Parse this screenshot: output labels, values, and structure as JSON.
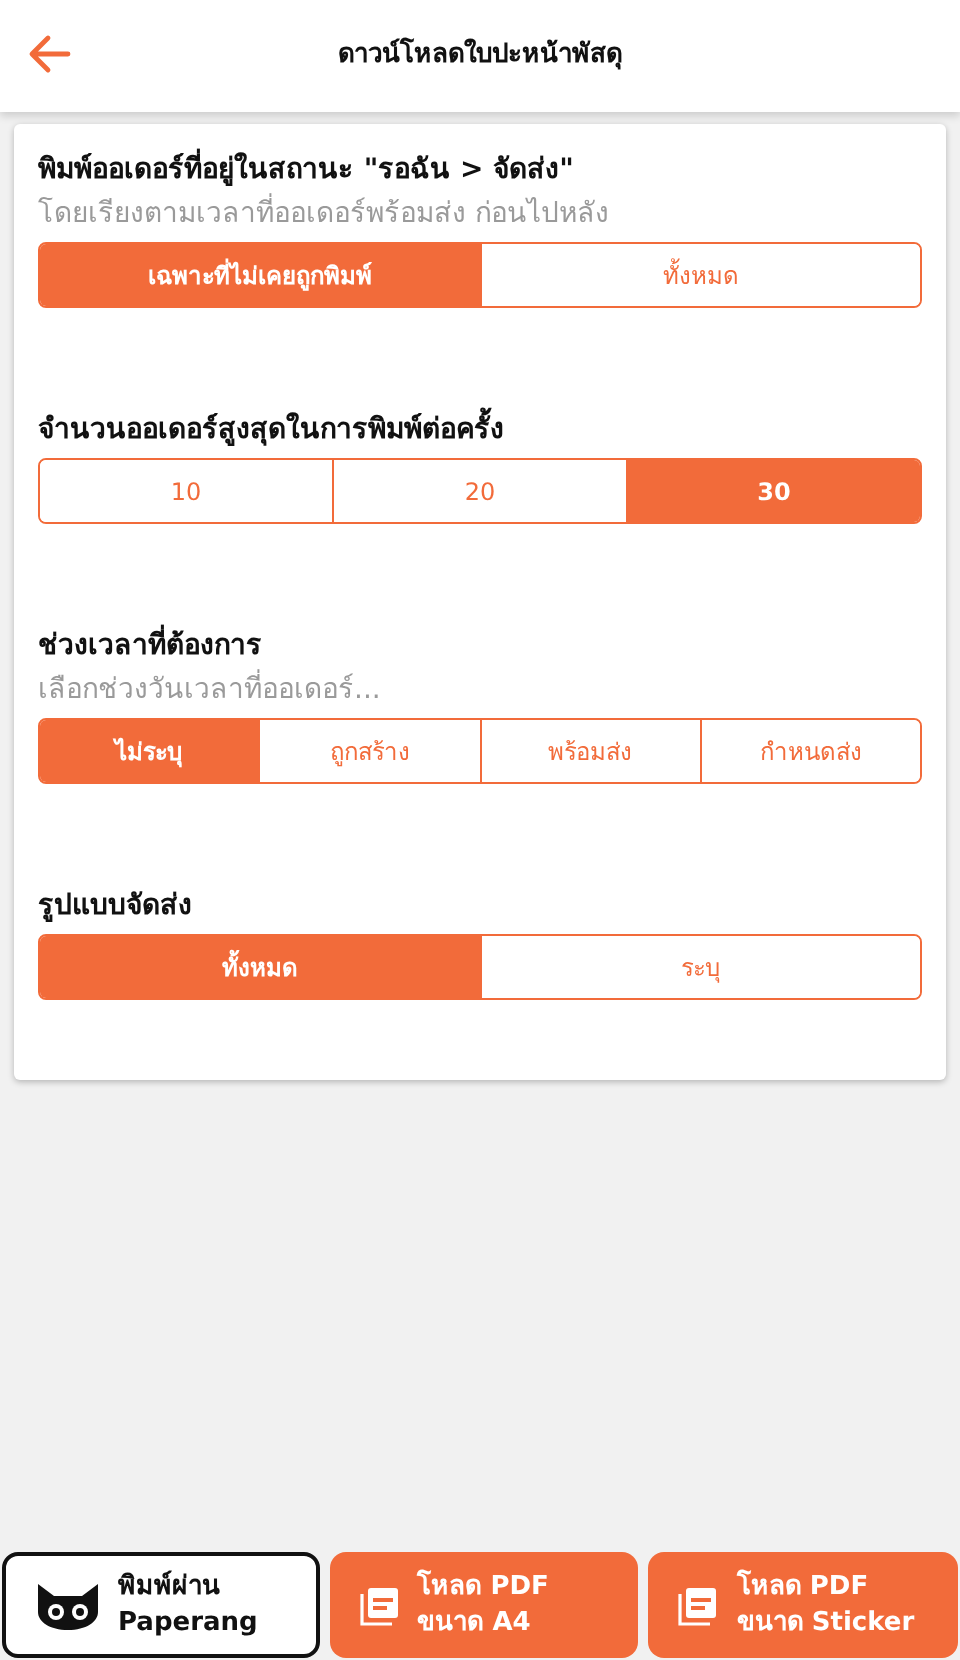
{
  "header": {
    "title": "ดาวน์โหลดใบปะหน้าพัสดุ"
  },
  "sections": [
    {
      "title": "พิมพ์ออเดอร์ที่อยู่ในสถานะ \"รอฉัน > จัดส่ง\"",
      "subtitle": "โดยเรียงตามเวลาที่ออเดอร์พร้อมส่ง ก่อนไปหลัง",
      "options": [
        {
          "label": "เฉพาะที่ไม่เคยถูกพิมพ์",
          "selected": true
        },
        {
          "label": "ทั้งหมด",
          "selected": false
        }
      ]
    },
    {
      "title": "จำนวนออเดอร์สูงสุดในการพิมพ์ต่อครั้ง",
      "options": [
        {
          "label": "10",
          "selected": false
        },
        {
          "label": "20",
          "selected": false
        },
        {
          "label": "30",
          "selected": true
        }
      ]
    },
    {
      "title": "ช่วงเวลาที่ต้องการ",
      "subtitle": "เลือกช่วงวันเวลาที่ออเดอร์...",
      "options": [
        {
          "label": "ไม่ระบุ",
          "selected": true
        },
        {
          "label": "ถูกสร้าง",
          "selected": false
        },
        {
          "label": "พร้อมส่ง",
          "selected": false
        },
        {
          "label": "กำหนดส่ง",
          "selected": false
        }
      ]
    },
    {
      "title": "รูปแบบจัดส่ง",
      "options": [
        {
          "label": "ทั้งหมด",
          "selected": true
        },
        {
          "label": "ระบุ",
          "selected": false
        }
      ]
    }
  ],
  "actions": [
    {
      "kind": "printer",
      "lines": [
        "พิมพ์ผ่าน",
        "Paperang"
      ]
    },
    {
      "kind": "pdf",
      "lines": [
        "โหลด PDF",
        "ขนาด A4"
      ]
    },
    {
      "kind": "pdf",
      "lines": [
        "โหลด PDF",
        "ขนาด Sticker"
      ]
    }
  ]
}
